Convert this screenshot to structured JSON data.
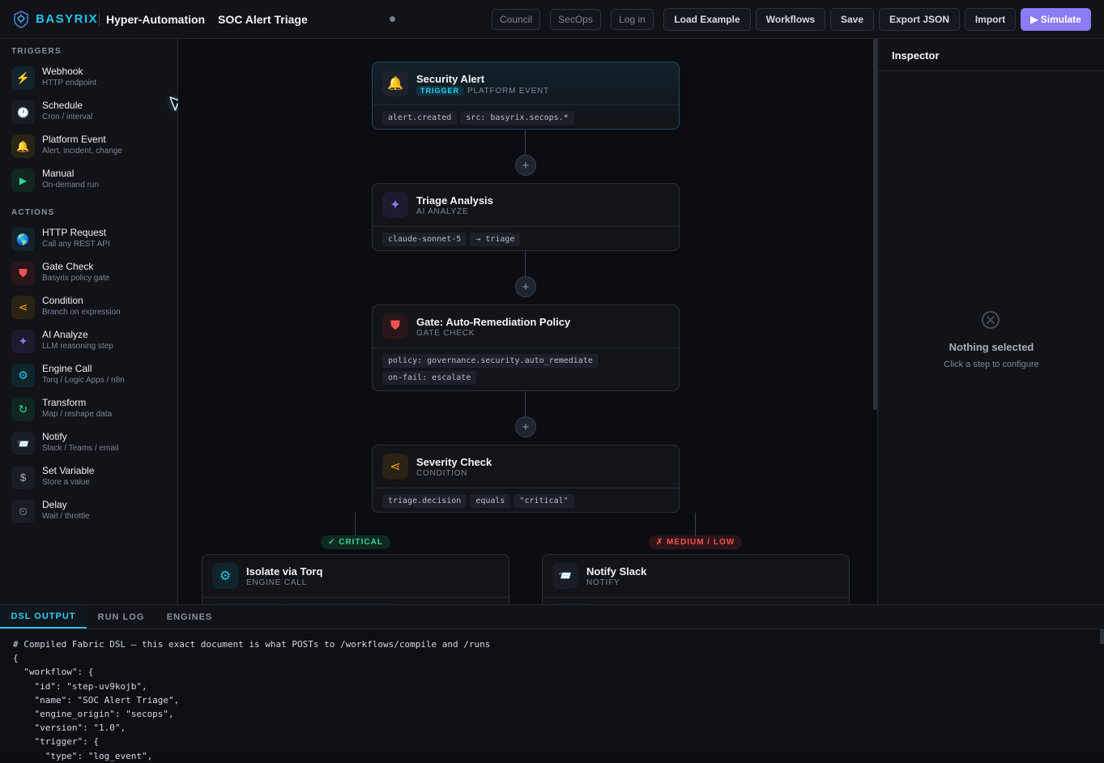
{
  "header": {
    "brand": "BASYRIX",
    "product": "Hyper-Automation",
    "workflow_name": "SOC Alert Triage",
    "ghost_buttons": [
      "Council",
      "SecOps",
      "Log in"
    ],
    "buttons": [
      "Load Example",
      "Workflows",
      "Save",
      "Export JSON",
      "Import"
    ],
    "simulate_label": "▶ Simulate"
  },
  "sidebar": {
    "triggers_label": "TRIGGERS",
    "triggers": [
      {
        "title": "Webhook",
        "sub": "HTTP endpoint",
        "icon": "bolt-icon",
        "glyph": "⚡"
      },
      {
        "title": "Schedule",
        "sub": "Cron / interval",
        "icon": "clock-icon",
        "glyph": "🕐"
      },
      {
        "title": "Platform Event",
        "sub": "Alert, incident, change",
        "icon": "bell-icon",
        "glyph": "🔔"
      },
      {
        "title": "Manual",
        "sub": "On-demand run",
        "icon": "play-icon",
        "glyph": "▶"
      }
    ],
    "actions_label": "ACTIONS",
    "actions": [
      {
        "title": "HTTP Request",
        "sub": "Call any REST API",
        "icon": "globe-icon",
        "glyph": "🌎"
      },
      {
        "title": "Gate Check",
        "sub": "Basyrix policy gate",
        "icon": "shield-icon",
        "glyph": "⛊"
      },
      {
        "title": "Condition",
        "sub": "Branch on expression",
        "icon": "branch-icon",
        "glyph": "⋖"
      },
      {
        "title": "AI Analyze",
        "sub": "LLM reasoning step",
        "icon": "sparkle-icon",
        "glyph": "✦"
      },
      {
        "title": "Engine Call",
        "sub": "Torq / Logic Apps / n8n",
        "icon": "gear-icon",
        "glyph": "⚙"
      },
      {
        "title": "Transform",
        "sub": "Map / reshape data",
        "icon": "refresh-icon",
        "glyph": "↻"
      },
      {
        "title": "Notify",
        "sub": "Slack / Teams / email",
        "icon": "envelope-icon",
        "glyph": "📨"
      },
      {
        "title": "Set Variable",
        "sub": "Store a value",
        "icon": "dollar-icon",
        "glyph": "$"
      },
      {
        "title": "Delay",
        "sub": "Wait / throttle",
        "icon": "timer-icon",
        "glyph": "⏲"
      }
    ]
  },
  "canvas": {
    "nodes": [
      {
        "title": "Security Alert",
        "tag": "TRIGGER",
        "sub": "PLATFORM EVENT",
        "chips": [
          "alert.created",
          "src: basyrix.secops.*"
        ]
      },
      {
        "title": "Triage Analysis",
        "sub": "AI ANALYZE",
        "chips": [
          "claude-sonnet-5",
          "→ triage"
        ]
      },
      {
        "title": "Gate: Auto-Remediation Policy",
        "sub": "GATE CHECK",
        "chips": [
          "policy: governance.security.auto_remediate",
          "on-fail: escalate"
        ]
      },
      {
        "title": "Severity Check",
        "sub": "CONDITION",
        "chips": [
          "triage.decision",
          "equals",
          "\"critical\""
        ]
      },
      {
        "title": "Isolate via Torq",
        "sub": "ENGINE CALL"
      },
      {
        "title": "Notify Slack",
        "sub": "NOTIFY"
      }
    ],
    "add_step_glyph": "+",
    "branch_true": "✓ CRITICAL",
    "branch_false": "✗ MEDIUM / LOW"
  },
  "inspector": {
    "title": "Inspector",
    "empty_title": "Nothing selected",
    "empty_sub": "Click a step to configure"
  },
  "bottom": {
    "tabs": [
      "DSL OUTPUT",
      "RUN LOG",
      "ENGINES"
    ],
    "active_tab": "DSL OUTPUT",
    "code_lines": [
      "# Compiled Fabric DSL — this exact document is what POSTs to /workflows/compile and /runs",
      "{",
      "  \"workflow\": {",
      "    \"id\": \"step-uv9kojb\",",
      "    \"name\": \"SOC Alert Triage\",",
      "    \"engine_origin\": \"secops\",",
      "    \"version\": \"1.0\",",
      "    \"trigger\": {",
      "      \"type\": \"log_event\","
    ]
  },
  "colors": {
    "accent": "#22c4e8",
    "primary": "#8b7cf6",
    "critical": "#34d399",
    "medium_low": "#f05252"
  }
}
